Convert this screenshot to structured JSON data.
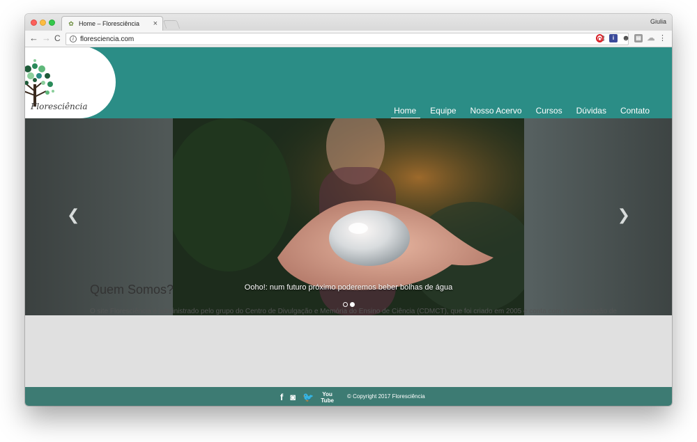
{
  "browser": {
    "tab_title": "Home – Floresciência",
    "tab_close": "×",
    "profile_name": "Giulia",
    "url": "floresciencia.com",
    "info_glyph": "i",
    "back_glyph": "←",
    "forward_glyph": "→",
    "reload_glyph": "C",
    "key_glyph": "⚷",
    "star_glyph": "☆",
    "menu_glyph": "⋮",
    "extensions": [
      {
        "name": "opera-extension-icon",
        "glyph": "O"
      },
      {
        "name": "blue-extension-icon",
        "glyph": "i"
      },
      {
        "name": "mask-extension-icon",
        "glyph": "☻"
      },
      {
        "name": "gray-extension-icon",
        "glyph": "▤"
      },
      {
        "name": "cloud-extension-icon",
        "glyph": "☁"
      }
    ]
  },
  "site": {
    "logo_text": "Floresciência",
    "nav": [
      {
        "label": "Home",
        "active": true
      },
      {
        "label": "Equipe"
      },
      {
        "label": "Nosso Acervo"
      },
      {
        "label": "Cursos"
      },
      {
        "label": "Dúvidas"
      },
      {
        "label": "Contato"
      }
    ],
    "colors": {
      "header": "#2b8d86",
      "footer": "#3d7b73"
    }
  },
  "slider": {
    "caption": "Ooho!: num futuro próximo poderemos beber bolhas de água",
    "prev_glyph": "❮",
    "next_glyph": "❯",
    "active_slide": 2,
    "slide_count": 2
  },
  "about": {
    "title": "Quem Somos?",
    "text": "O site Floresciência é administrado pelo grupo do Centro de Divulgação e Memória do Ensino de Ciência (CDMCT), que foi criado em 2005 e conta com a colaboração de"
  },
  "footer": {
    "facebook_glyph": "f",
    "instagram_glyph": "◙",
    "twitter_glyph": "🐦",
    "youtube_glyph": "You\nTube",
    "copyright": "© Copyright 2017 Floresciência"
  }
}
